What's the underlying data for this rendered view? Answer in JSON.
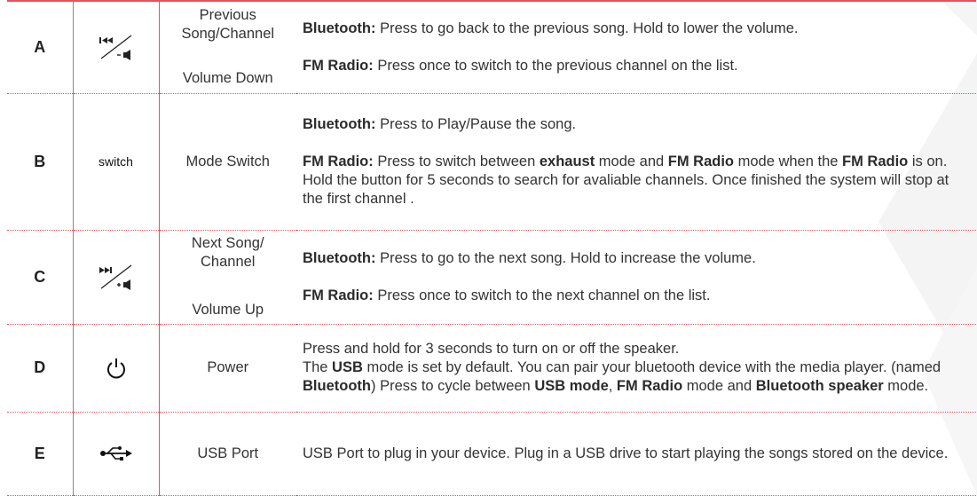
{
  "rows": [
    {
      "letter": "A",
      "icon": "prev-volume-down-icon",
      "name_lines": [
        "Previous",
        "Song/Channel"
      ],
      "name_secondary": "Volume Down",
      "desc": [
        [
          {
            "t": "Bluetooth:",
            "b": true
          },
          {
            "t": " Press to go back to the previous song. Hold to lower the volume."
          }
        ],
        [
          {
            "t": "FM Radio:",
            "b": true
          },
          {
            "t": " Press once to switch to the previous channel on the list."
          }
        ]
      ]
    },
    {
      "letter": "B",
      "icon_text": "switch",
      "name_lines": [
        "Mode Switch"
      ],
      "desc": [
        [
          {
            "t": "Bluetooth:",
            "b": true
          },
          {
            "t": " Press to Play/Pause the song."
          }
        ],
        [
          {
            "t": "FM Radio:",
            "b": true
          },
          {
            "t": " Press to switch between "
          },
          {
            "t": "exhaust",
            "b": true
          },
          {
            "t": " mode and "
          },
          {
            "t": "FM Radio",
            "b": true
          },
          {
            "t": " mode when the "
          },
          {
            "t": "FM Radio",
            "b": true
          },
          {
            "t": " is on."
          }
        ],
        [
          {
            "t": "Hold the button for 5 seconds to search for avaliable channels. Once finished the system will stop at the first channel ."
          }
        ]
      ]
    },
    {
      "letter": "C",
      "icon": "next-volume-up-icon",
      "name_lines": [
        "Next Song/",
        "Channel"
      ],
      "name_secondary": "Volume Up",
      "desc": [
        [
          {
            "t": "Bluetooth:",
            "b": true
          },
          {
            "t": " Press to go to the next song. Hold to increase the volume."
          }
        ],
        [
          {
            "t": "FM Radio:",
            "b": true
          },
          {
            "t": " Press once to switch to the next channel on the list."
          }
        ]
      ]
    },
    {
      "letter": "D",
      "icon": "power-icon",
      "name_lines": [
        "Power"
      ],
      "desc": [
        [
          {
            "t": "Press and hold for 3 seconds to turn on or off the speaker."
          }
        ],
        [
          {
            "t": "The "
          },
          {
            "t": "USB",
            "b": true
          },
          {
            "t": " mode is set by default. You can pair your bluetooth device with the media player. (named "
          },
          {
            "t": "Bluetooth",
            "b": true
          },
          {
            "t": ") Press to cycle between "
          },
          {
            "t": "USB mode",
            "b": true
          },
          {
            "t": ", "
          },
          {
            "t": "FM Radio",
            "b": true
          },
          {
            "t": " mode and "
          },
          {
            "t": "Bluetooth speaker",
            "b": true
          },
          {
            "t": " mode."
          }
        ]
      ]
    },
    {
      "letter": "E",
      "icon": "usb-icon",
      "name_lines": [
        "USB Port"
      ],
      "desc": [
        [
          {
            "t": "USB Port to plug in your device. Plug in a USB drive to start playing the songs stored on the device."
          }
        ]
      ]
    }
  ],
  "colors": {
    "accent": "#e8505b",
    "text": "#333333",
    "divider": "#888888"
  }
}
